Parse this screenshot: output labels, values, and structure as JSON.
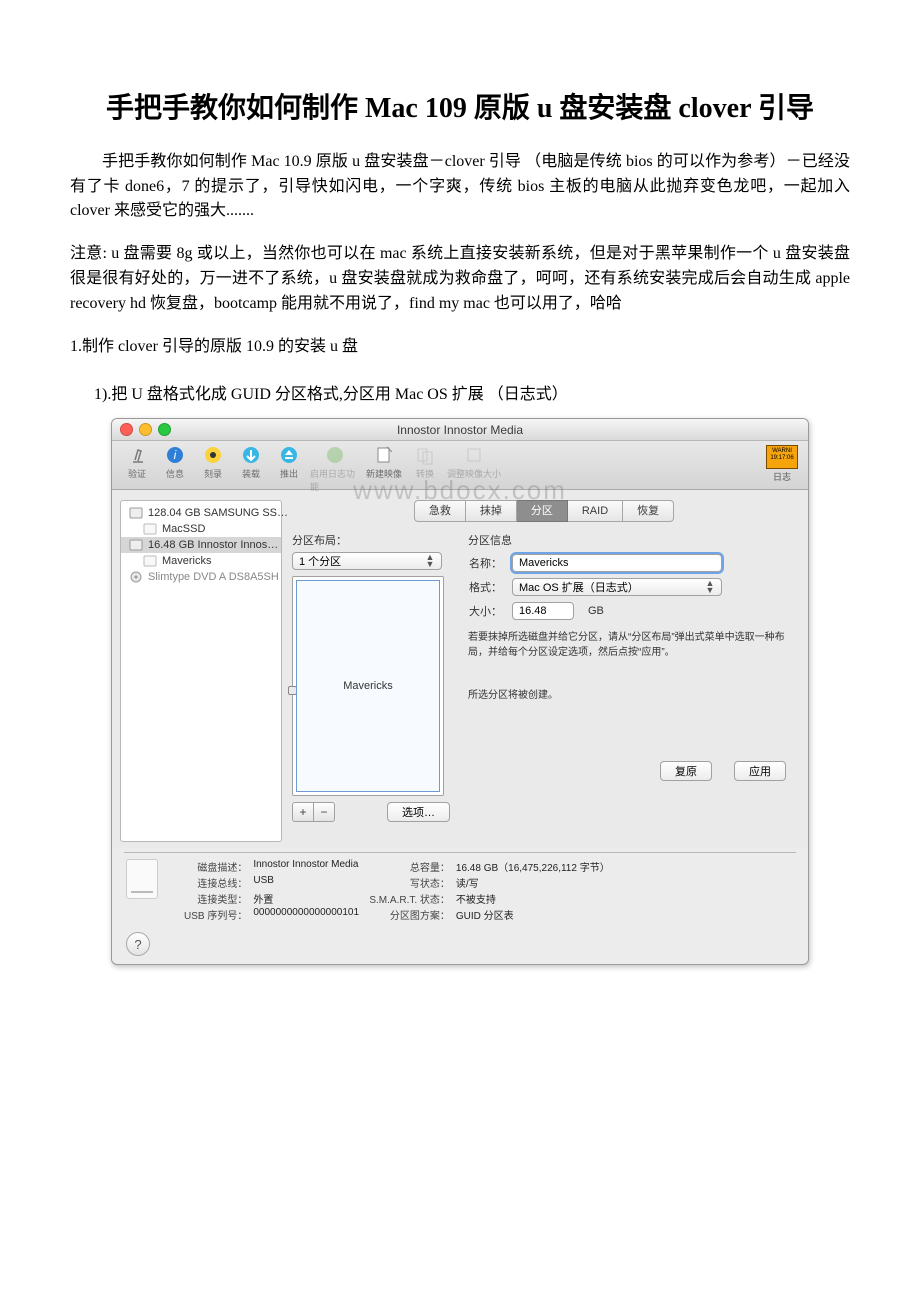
{
  "doc": {
    "title": "手把手教你如何制作 Mac 109 原版 u 盘安装盘 clover 引导",
    "intro": "手把手教你如何制作 Mac 10.9 原版 u 盘安装盘－clover 引导 （电脑是传统 bios 的可以作为参考）－已经没有了卡 done6，7 的提示了，引导快如闪电，一个字爽，传统 bios 主板的电脑从此抛弃变色龙吧，一起加入 clover 来感受它的强大.......",
    "note": "注意: u 盘需要 8g 或以上，当然你也可以在 mac 系统上直接安装新系统，但是对于黑苹果制作一个 u 盘安装盘很是很有好处的，万一进不了系统，u 盘安装盘就成为救命盘了，呵呵，还有系统安装完成后会自动生成 apple recovery hd 恢复盘，bootcamp 能用就不用说了，find my mac 也可以用了，哈哈",
    "step1": "1.制作 clover 引导的原版 10.9 的安装 u 盘",
    "substep1": "1).把 U 盘格式化成 GUID 分区格式,分区用 Mac OS 扩展 （日志式）"
  },
  "window": {
    "title": "Innostor Innostor Media",
    "watermark": "www.bdocx.com",
    "toolbar": {
      "t0": "验证",
      "t1": "信息",
      "t2": "刻录",
      "t3": "装载",
      "t4": "推出",
      "t5": "启用日志功能",
      "t6": "新建映像",
      "t7": "转换",
      "t8": "调整映像大小",
      "log": "日志",
      "warn": "WARNI\n19:17:06"
    },
    "sidebar": {
      "i0": "128.04 GB SAMSUNG SS…",
      "i1": "MacSSD",
      "i2": "16.48 GB Innostor Innos…",
      "i3": "Mavericks",
      "i4": "Slimtype DVD A DS8A5SH"
    },
    "tabs": {
      "t0": "急救",
      "t1": "抹掉",
      "t2": "分区",
      "t3": "RAID",
      "t4": "恢复"
    },
    "left": {
      "layout_label": "分区布局：",
      "layout_value": "1 个分区",
      "partition_name": "Mavericks",
      "plus": "+",
      "minus": "−",
      "options": "选项…"
    },
    "right": {
      "heading": "分区信息",
      "name_label": "名称：",
      "name_value": "Mavericks",
      "format_label": "格式：",
      "format_value": "Mac OS 扩展（日志式）",
      "size_label": "大小：",
      "size_value": "16.48",
      "size_unit": "GB",
      "note": "若要抹掉所选磁盘并给它分区，请从“分区布局”弹出式菜单中选取一种布局，并给每个分区设定选项，然后点按“应用”。",
      "note2": "所选分区将被创建。",
      "revert": "复原",
      "apply": "应用"
    },
    "info": {
      "k0": "磁盘描述：",
      "v0": "Innostor Innostor Media",
      "k1": "连接总线：",
      "v1": "USB",
      "k2": "连接类型：",
      "v2": "外置",
      "k3": "USB 序列号：",
      "v3": "0000000000000000101",
      "k4": "总容量：",
      "v4": "16.48 GB（16,475,226,112 字节）",
      "k5": "写状态：",
      "v5": "读/写",
      "k6": "S.M.A.R.T. 状态：",
      "v6": "不被支持",
      "k7": "分区图方案：",
      "v7": "GUID 分区表"
    },
    "help": "?"
  }
}
